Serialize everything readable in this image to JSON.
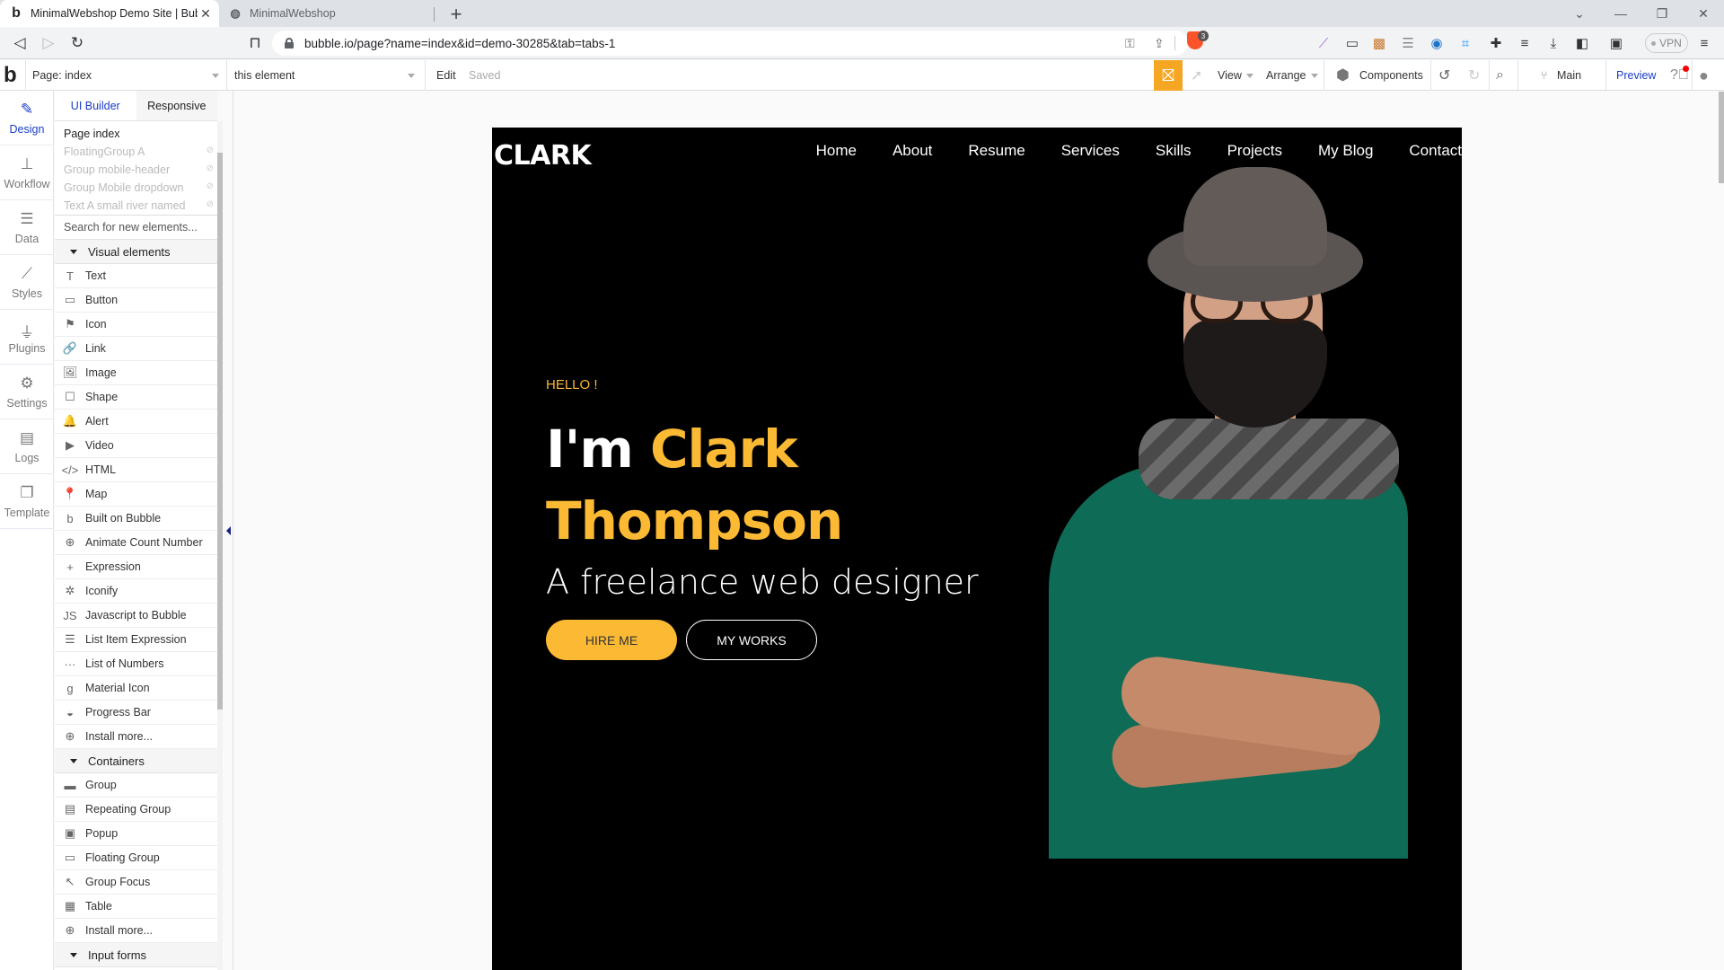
{
  "browser": {
    "tabs": [
      {
        "title": "MinimalWebshop Demo Site | Bubble",
        "active": true,
        "icon": "bubble-logo-icon"
      },
      {
        "title": "MinimalWebshop",
        "active": false,
        "icon": "globe-icon"
      }
    ],
    "new_tab": "+",
    "url": "bubble.io/page?name=index&id=demo-30285&tab=tabs-1",
    "brave_badge": "3",
    "vpn_label": "VPN",
    "window_controls": [
      "chevron-down-icon",
      "minimize-icon",
      "restore-icon",
      "close-icon"
    ]
  },
  "editor_toolbar": {
    "page_selector": "Page: index",
    "element_selector": "this element",
    "edit_label": "Edit",
    "save_status": "Saved",
    "view_label": "View",
    "arrange_label": "Arrange",
    "components_label": "Components",
    "branch_label": "Main",
    "preview_label": "Preview"
  },
  "rail": [
    {
      "label": "Design",
      "icon": "design-icon",
      "active": true
    },
    {
      "label": "Workflow",
      "icon": "workflow-icon",
      "active": false
    },
    {
      "label": "Data",
      "icon": "database-icon",
      "active": false
    },
    {
      "label": "Styles",
      "icon": "brush-icon",
      "active": false
    },
    {
      "label": "Plugins",
      "icon": "plug-icon",
      "active": false
    },
    {
      "label": "Settings",
      "icon": "gear-icon",
      "active": false
    },
    {
      "label": "Logs",
      "icon": "document-icon",
      "active": false
    },
    {
      "label": "Template",
      "icon": "template-icon",
      "active": false
    }
  ],
  "panel": {
    "tabs": [
      "UI Builder",
      "Responsive"
    ],
    "tree": [
      {
        "label": "Page index",
        "hidden": false
      },
      {
        "label": "FloatingGroup A",
        "hidden": true
      },
      {
        "label": "Group mobile-header",
        "hidden": true
      },
      {
        "label": "Group Mobile dropdown",
        "hidden": true
      },
      {
        "label": "Text A small river named",
        "hidden": true
      }
    ],
    "search_placeholder": "Search for new elements...",
    "sections": [
      {
        "title": "Visual elements",
        "items": [
          {
            "label": "Text",
            "icon": "T"
          },
          {
            "label": "Button",
            "icon": "▭"
          },
          {
            "label": "Icon",
            "icon": "⚑"
          },
          {
            "label": "Link",
            "icon": "🔗"
          },
          {
            "label": "Image",
            "icon": "🖼"
          },
          {
            "label": "Shape",
            "icon": "☐"
          },
          {
            "label": "Alert",
            "icon": "🔔"
          },
          {
            "label": "Video",
            "icon": "▶"
          },
          {
            "label": "HTML",
            "icon": "</>"
          },
          {
            "label": "Map",
            "icon": "📍"
          },
          {
            "label": "Built on Bubble",
            "icon": "b"
          },
          {
            "label": "Animate Count Number",
            "icon": "⊕"
          },
          {
            "label": "Expression",
            "icon": "+"
          },
          {
            "label": "Iconify",
            "icon": "✲"
          },
          {
            "label": "Javascript to Bubble",
            "icon": "JS"
          },
          {
            "label": "List Item Expression",
            "icon": "☰"
          },
          {
            "label": "List of Numbers",
            "icon": "···"
          },
          {
            "label": "Material Icon",
            "icon": "g"
          },
          {
            "label": "Progress Bar",
            "icon": "◒"
          },
          {
            "label": "Install more...",
            "icon": "⊕"
          }
        ]
      },
      {
        "title": "Containers",
        "items": [
          {
            "label": "Group",
            "icon": "▬"
          },
          {
            "label": "Repeating Group",
            "icon": "▤"
          },
          {
            "label": "Popup",
            "icon": "▣"
          },
          {
            "label": "Floating Group",
            "icon": "▭"
          },
          {
            "label": "Group Focus",
            "icon": "↖"
          },
          {
            "label": "Table",
            "icon": "▦"
          },
          {
            "label": "Install more...",
            "icon": "⊕"
          }
        ]
      },
      {
        "title": "Input forms",
        "items": []
      }
    ]
  },
  "site": {
    "logo": "CLARK",
    "nav": [
      "Home",
      "About",
      "Resume",
      "Services",
      "Skills",
      "Projects",
      "My Blog",
      "Contact"
    ],
    "greeting": "HELLO !",
    "headline_prefix": "I'm",
    "headline_first": "Clark",
    "headline_last": "Thompson",
    "subtitle": "A freelance web designer",
    "cta_primary": "HIRE ME",
    "cta_secondary": "MY WORKS",
    "accent_color": "#fbb934",
    "portrait_alt": "Bearded man in hat, glasses, scarf and green sweater with arms crossed"
  }
}
